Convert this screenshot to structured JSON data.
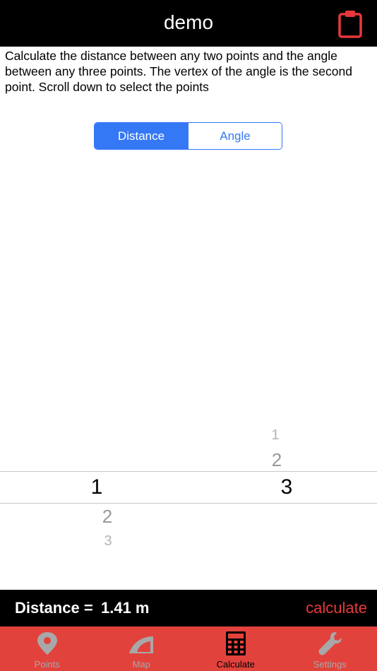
{
  "header": {
    "title": "demo",
    "clipboard_icon": "clipboard-icon"
  },
  "description": "Calculate the distance between any two points and the angle between any three points.  The vertex of the angle is the second point. Scroll down to select the points",
  "segmented": {
    "options": [
      "Distance",
      "Angle"
    ],
    "selected": "Distance",
    "accent": "#3478f6"
  },
  "picker": {
    "left_column": {
      "selected": "1",
      "below": [
        "2",
        "3"
      ]
    },
    "right_column": {
      "above": [
        "1",
        "2"
      ],
      "selected": "3"
    }
  },
  "result": {
    "label": "Distance =",
    "value": "1.41 m",
    "calculate_label": "calculate",
    "accent": "#e8383b"
  },
  "tabbar": {
    "background": "#e2423c",
    "tabs": [
      {
        "label": "Points",
        "icon": "map-pin-icon",
        "active": false
      },
      {
        "label": "Map",
        "icon": "protractor-icon",
        "active": false
      },
      {
        "label": "Calculate",
        "icon": "calculator-icon",
        "active": true
      },
      {
        "label": "Settings",
        "icon": "wrench-icon",
        "active": false
      }
    ]
  }
}
